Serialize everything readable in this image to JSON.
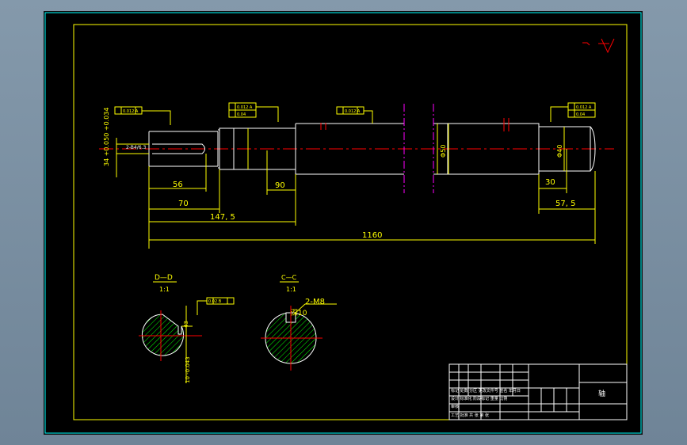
{
  "drawing": {
    "title_block_name": "轴",
    "dimensions": {
      "d_56": "56",
      "d_70": "70",
      "d_147_5": "147, 5",
      "d_1160": "1160",
      "d_90": "90",
      "d_30": "30",
      "d_57_5": "57, 5",
      "d_34_tol": "34 +0.050 +0.034",
      "d_phi": "Φ40",
      "d_phi50": "Φ50",
      "d_2m8": "2-M8",
      "d_depth": "深10",
      "d_43": "43",
      "d_10_tol": "10 -0.043",
      "d_chamfer": "2-B4/6.3"
    },
    "sections": {
      "section_dd_label": "D—D",
      "section_dd_scale": "1:1",
      "section_cc_label": "C—C",
      "section_cc_scale": "1:1"
    },
    "tolerance_frames": {
      "runout": "0.012 A",
      "flatness": "0.04",
      "sym": "0.02 B"
    },
    "title_block_rows": {
      "row1": "标记 处数 分区 更改文件号 签名 年月日",
      "row2": "设计 标准化 阶段标记 重量 比例",
      "row3": "审核",
      "row4": "工艺 批准 共 张 第 张"
    },
    "colors": {
      "background": "#000000",
      "frame": "#ffff00",
      "outline": "#ffffff",
      "center": "#ff0000",
      "hatch": "#00ff00",
      "break": "#ff00ff",
      "border": "#00ffff"
    }
  }
}
